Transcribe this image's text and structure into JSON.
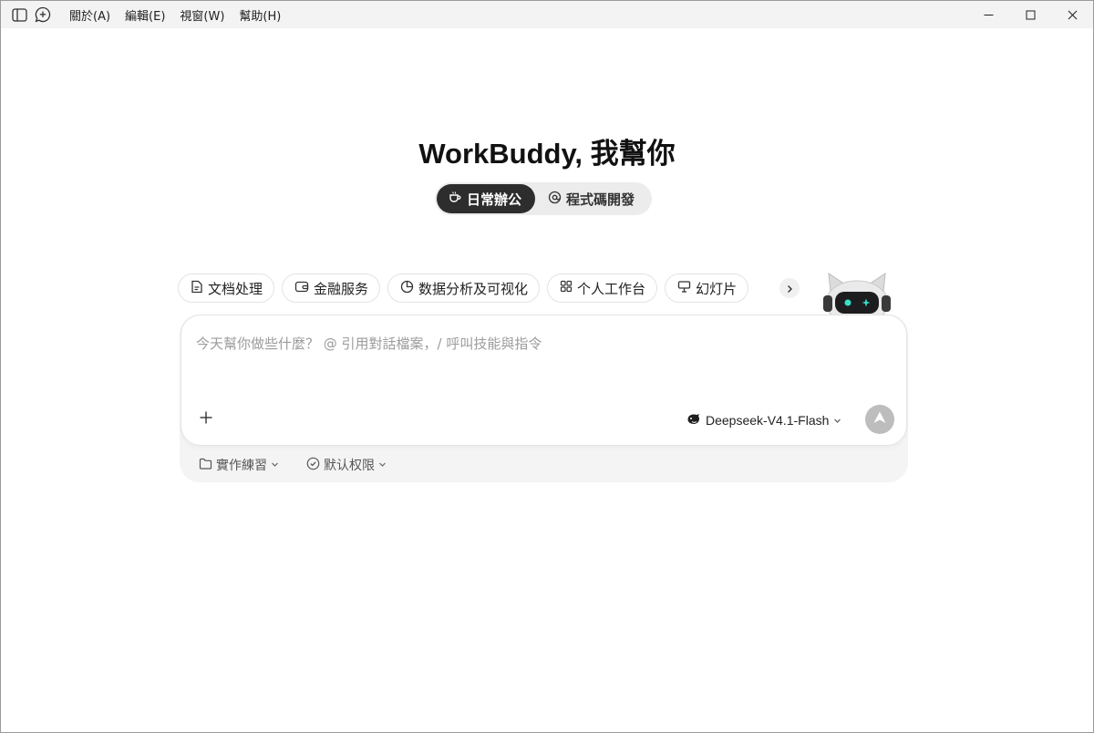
{
  "menu": {
    "items": [
      "關於(A)",
      "編輯(E)",
      "視窗(W)",
      "幫助(H)"
    ]
  },
  "hero": {
    "title": "WorkBuddy, 我幫你"
  },
  "modes": {
    "active_label": "日常辦公",
    "inactive_label": "程式碼開發"
  },
  "categories": {
    "items": [
      {
        "label": "文档处理",
        "icon": "document-icon"
      },
      {
        "label": "金融服务",
        "icon": "wallet-icon"
      },
      {
        "label": "数据分析及可视化",
        "icon": "pie-chart-icon"
      },
      {
        "label": "个人工作台",
        "icon": "grid-icon"
      },
      {
        "label": "幻灯片",
        "icon": "presentation-icon"
      }
    ]
  },
  "input": {
    "placeholder": "今天幫你做些什麼？ @ 引用對話檔案，/ 呼叫技能與指令"
  },
  "model": {
    "label": "Deepseek-V4.1-Flash"
  },
  "footer": {
    "folder_label": "實作練習",
    "permission_label": "默认权限"
  },
  "colors": {
    "active_mode_bg": "#2d2d2d",
    "send_button": "#bdbdbd",
    "panel_bg": "#f4f4f4"
  }
}
